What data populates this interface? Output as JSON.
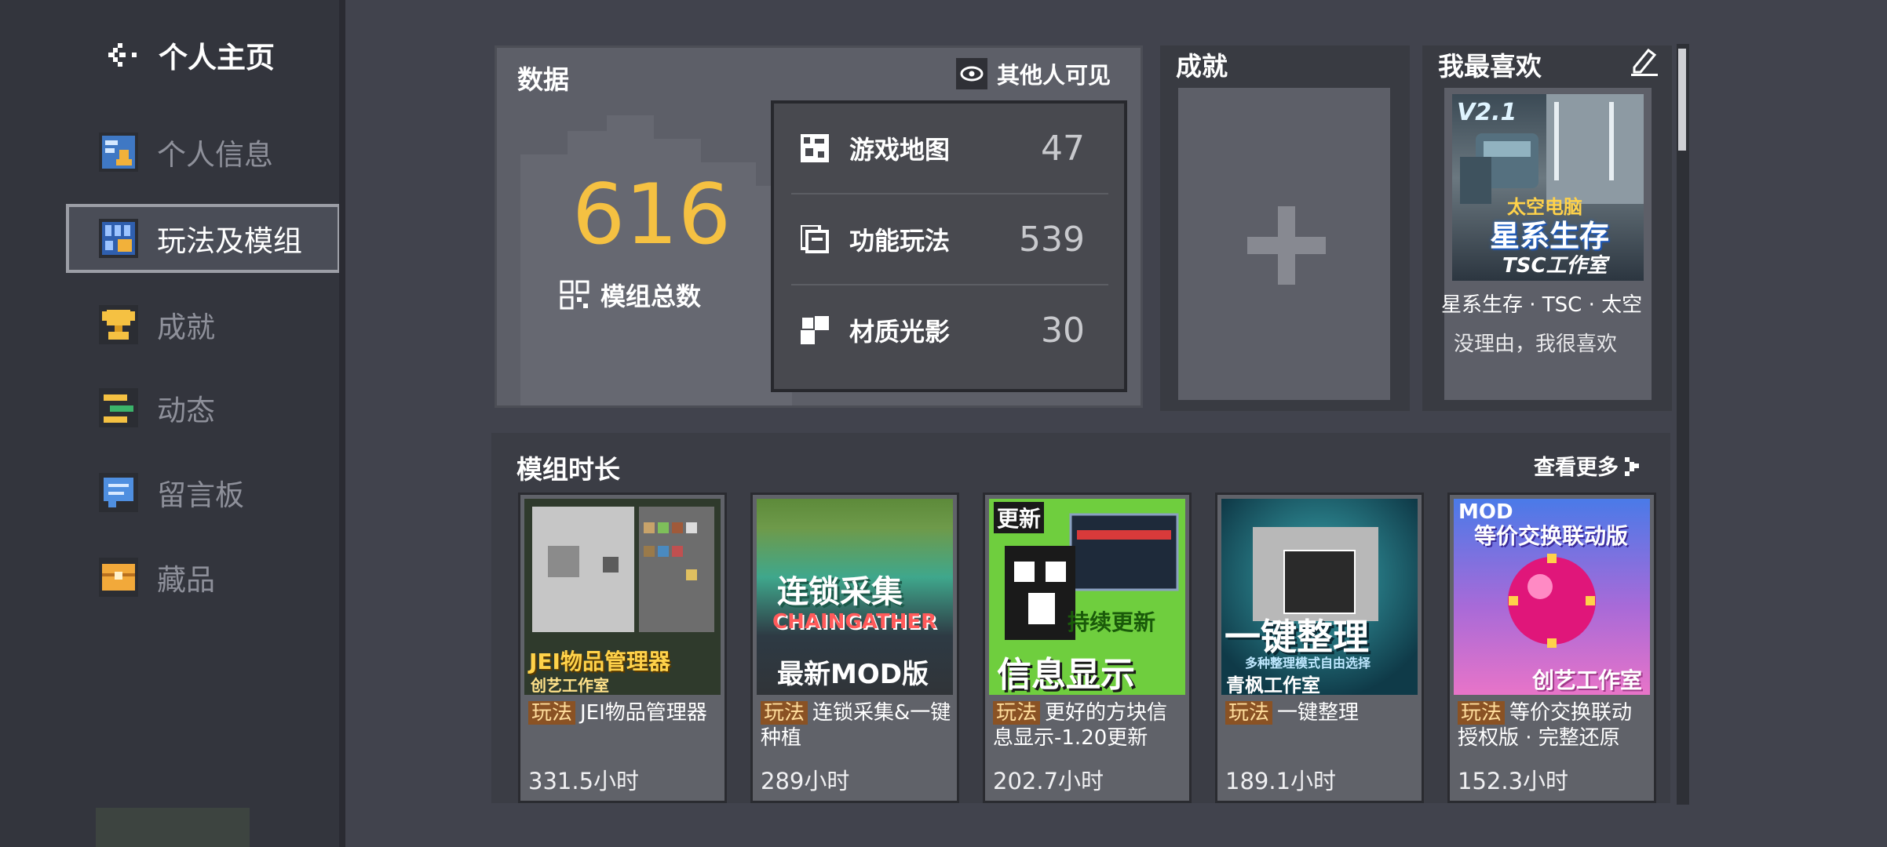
{
  "sidebar": {
    "title": "个人主页",
    "items": [
      {
        "label": "个人信息",
        "icon": "id-card-icon",
        "active": false
      },
      {
        "label": "玩法及模组",
        "icon": "mods-icon",
        "active": true
      },
      {
        "label": "成就",
        "icon": "trophy-icon",
        "active": false
      },
      {
        "label": "动态",
        "icon": "activity-icon",
        "active": false
      },
      {
        "label": "留言板",
        "icon": "message-board-icon",
        "active": false
      },
      {
        "label": "藏品",
        "icon": "collection-icon",
        "active": false
      }
    ]
  },
  "data_panel": {
    "title": "数据",
    "visibility": "其他人可见",
    "total": "616",
    "total_label": "模组总数",
    "stats": [
      {
        "label": "游戏地图",
        "value": "47"
      },
      {
        "label": "功能玩法",
        "value": "539"
      },
      {
        "label": "材质光影",
        "value": "30"
      }
    ]
  },
  "achievements": {
    "title": "成就"
  },
  "favorites": {
    "title": "我最喜欢",
    "item_name": "星系生存 · TSC · 太空",
    "comment": "没理由，我很喜欢",
    "thumb_version": "V2.1",
    "thumb_line1": "太空电脑",
    "thumb_line2": "星系生存",
    "thumb_line3": "TSC工作室"
  },
  "mod_duration": {
    "title": "模组时长",
    "see_more": "查看更多",
    "cards": [
      {
        "tag": "玩法",
        "name": "JEI物品管理器",
        "time": "331.5小时",
        "thumb_title": "JEI物品管理器",
        "thumb_sub": "创艺工作室"
      },
      {
        "tag": "玩法",
        "name": "连锁采集&一键种植",
        "time": "289小时",
        "thumb_title": "连锁采集",
        "thumb_sub": "CHAINGATHER",
        "thumb_extra": "最新MOD版"
      },
      {
        "tag": "玩法",
        "name": "更好的方块信息显示-1.20更新",
        "time": "202.7小时",
        "thumb_title": "信息显示",
        "thumb_sub": "持续更新",
        "thumb_extra": "更新"
      },
      {
        "tag": "玩法",
        "name": "一键整理",
        "time": "189.1小时",
        "thumb_title": "一键整理",
        "thumb_sub": "青枫工作室",
        "thumb_extra": "多种整理模式自由选择"
      },
      {
        "tag": "玩法",
        "name": "等价交换联动授权版 · 完整还原",
        "time": "152.3小时",
        "thumb_title": "等价交换联动版",
        "thumb_sub": "创艺工作室",
        "thumb_extra": "MOD"
      }
    ]
  },
  "colors": {
    "accent": "#f5c142",
    "tag_bg": "#8a5224",
    "panel": "#5d5f68",
    "sidebar": "#33353d"
  }
}
